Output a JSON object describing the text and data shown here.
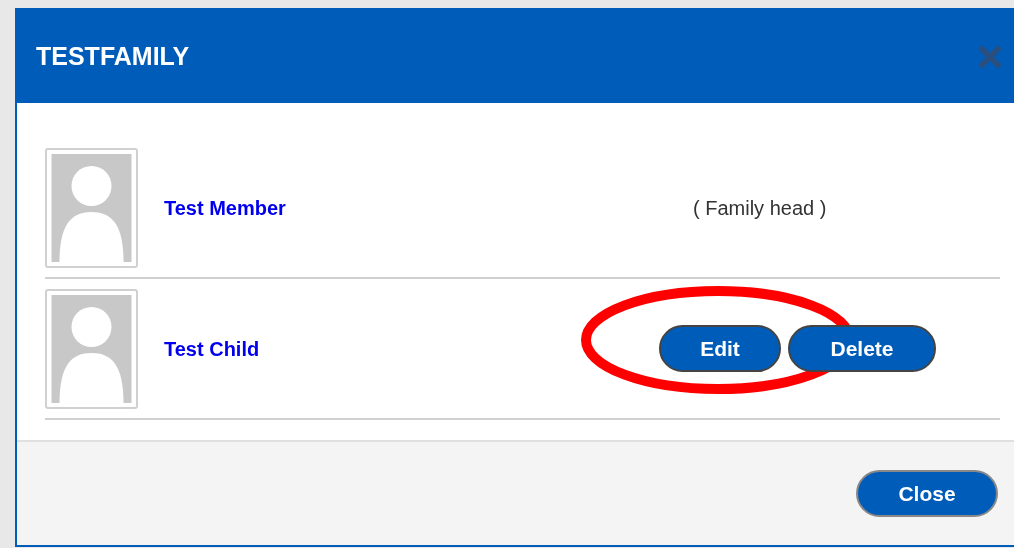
{
  "dialog": {
    "title": "TESTFAMILY"
  },
  "members": [
    {
      "kind": "label",
      "name": "Test Member",
      "note": "( Family head )"
    },
    {
      "kind": "actions",
      "name": "Test Child",
      "buttons": [
        "Edit",
        "Delete"
      ]
    }
  ],
  "footer": {
    "button": "Close"
  },
  "annotation": {
    "kind": "ellipse",
    "color": "#ff0000"
  }
}
